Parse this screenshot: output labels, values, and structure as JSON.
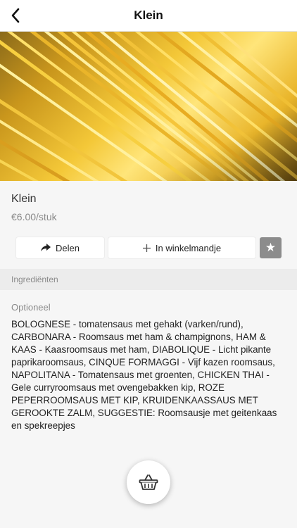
{
  "navbar": {
    "title": "Klein",
    "back_icon": "chevron-left-icon"
  },
  "hero": {
    "image": "spaghetti-photo"
  },
  "product": {
    "name": "Klein",
    "price": "€6.00/stuk"
  },
  "actions": {
    "share_label": "Delen",
    "share_icon": "share-arrow-icon",
    "cart_label": "In winkelmandje",
    "cart_icon": "plus-icon",
    "favorite_icon": "star-icon"
  },
  "ingredients_section": {
    "header": "Ingrediënten",
    "optional_label": "Optioneel",
    "text": "BOLOGNESE - tomatensaus met gehakt (varken/rund), CARBONARA - Roomsaus met ham & champignons, HAM & KAAS - Kaasroomsaus met ham, DIABOLIQUE - Licht pikante paprikaroomsaus, CINQUE FORMAGGI - Vijf kazen roomsaus, NAPOLITANA - Tomatensaus met groenten, CHICKEN THAI - Gele curryroomsaus met ovengebakken kip, ROZE PEPERROOMSAUS MET KIP, KRUIDENKAASSAUS MET GEROOKTE ZALM, SUGGESTIE: Roomsausje met geitenkaas en spekreepjes"
  },
  "basket": {
    "icon": "basket-icon"
  },
  "colors": {
    "favorite_bg": "#8c8c8c",
    "section_bg": "#ececec",
    "page_bg": "#f6f6f6"
  }
}
